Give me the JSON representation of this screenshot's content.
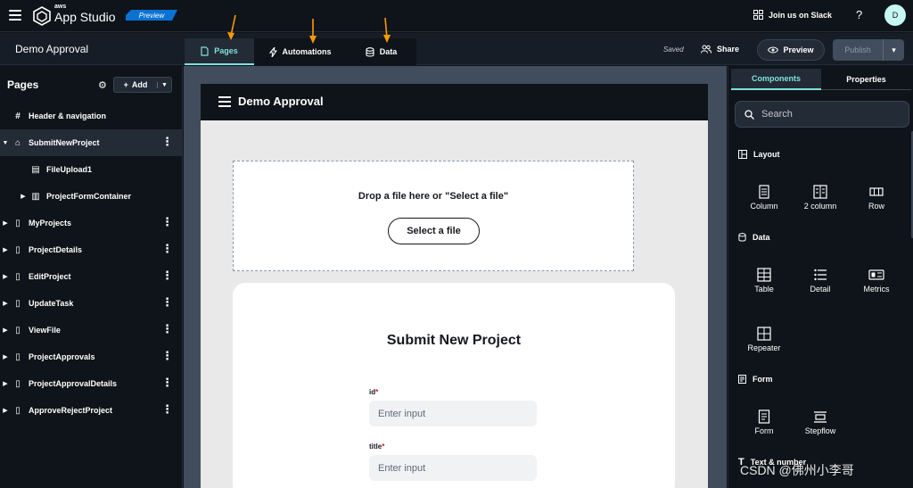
{
  "topbar": {
    "logo_small": "aws",
    "logo_main": "App Studio",
    "badge": "Preview",
    "slack": "Join us on Slack",
    "help": "?",
    "avatar": "D"
  },
  "appbar": {
    "app_name": "Demo Approval",
    "tabs": [
      {
        "label": "Pages",
        "icon": "page-icon"
      },
      {
        "label": "Automations",
        "icon": "bolt-icon"
      },
      {
        "label": "Data",
        "icon": "database-icon"
      }
    ],
    "active_tab": "Pages",
    "saved": "Saved",
    "share": "Share",
    "preview": "Preview",
    "publish": "Publish"
  },
  "sidebar": {
    "title": "Pages",
    "add": "Add",
    "items": [
      {
        "label": "Header & navigation",
        "icon": "hash-icon"
      },
      {
        "label": "SubmitNewProject",
        "icon": "home-icon"
      },
      {
        "label": "FileUpload1",
        "icon": "file-icon"
      },
      {
        "label": "ProjectFormContainer",
        "icon": "container-icon"
      },
      {
        "label": "MyProjects",
        "icon": "page-icon"
      },
      {
        "label": "ProjectDetails",
        "icon": "page-icon"
      },
      {
        "label": "EditProject",
        "icon": "page-icon"
      },
      {
        "label": "UpdateTask",
        "icon": "page-icon"
      },
      {
        "label": "ViewFile",
        "icon": "page-icon"
      },
      {
        "label": "ProjectApprovals",
        "icon": "page-icon"
      },
      {
        "label": "ProjectApprovalDetails",
        "icon": "page-icon"
      },
      {
        "label": "ApproveRejectProject",
        "icon": "page-icon"
      }
    ]
  },
  "canvas": {
    "header_title": "Demo Approval",
    "drop_text": "Drop a file here or \"Select a file\"",
    "select_file": "Select a file",
    "form_title": "Submit New Project",
    "fields": [
      {
        "label": "id",
        "required": "*",
        "placeholder": "Enter input"
      },
      {
        "label": "title",
        "required": "*",
        "placeholder": "Enter input"
      }
    ]
  },
  "rpanel": {
    "tabs": [
      "Components",
      "Properties"
    ],
    "active_tab": "Components",
    "search_placeholder": "Search",
    "sections": {
      "layout": "Layout",
      "data": "Data",
      "form": "Form",
      "text": "Text & number"
    },
    "layout_items": [
      "Column",
      "2 column",
      "Row"
    ],
    "data_items": [
      "Table",
      "Detail",
      "Metrics",
      "Repeater"
    ],
    "form_items": [
      "Form",
      "Stepflow"
    ]
  },
  "watermark": "CSDN @佛州小李哥",
  "colors": {
    "accent": "#7ee2d9",
    "arrow": "#ff9900",
    "badge": "#0972d3"
  }
}
